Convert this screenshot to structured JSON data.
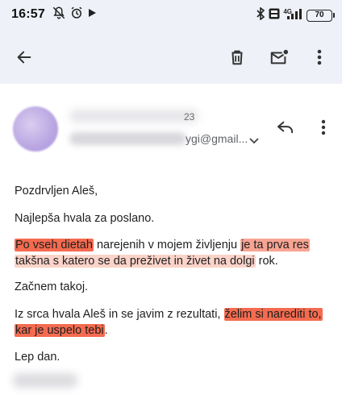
{
  "status_bar": {
    "time": "16:57",
    "network": "4G",
    "battery": "70",
    "icons": [
      "mute-icon",
      "alarm-icon",
      "play-icon",
      "bluetooth-icon",
      "volte-icon",
      "signal-icon",
      "battery-icon"
    ]
  },
  "toolbar": {
    "icons": [
      "back-arrow-icon",
      "trash-icon",
      "mark-unread-icon",
      "more-vert-icon"
    ]
  },
  "email": {
    "date_fragment": "23",
    "sender_address_fragment": "ygi@gmail...",
    "paragraphs": {
      "greeting": "Pozdrvljen Aleš,",
      "thanks": "Najlepša hvala za poslano.",
      "p3_line1": [
        "Po vseh dietah",
        " narejenih v mojem življenju ",
        "je ta prva res"
      ],
      "p3_line2": [
        "takšna s katero se da preživet in živet na dolgi",
        " rok."
      ],
      "p4": "Začnem takoj.",
      "p5_line1": [
        "Iz srca hvala Aleš in se javim z rezultati,  ",
        "želim si narediti to,"
      ],
      "p5_line2": [
        "kar je uspelo tebi",
        "."
      ],
      "closing": "Lep dan."
    }
  },
  "colors": {
    "header_bg": "#eef2f8",
    "highlight_strong": "#f46b4f",
    "highlight_mid": "#f8a493",
    "highlight_soft": "#fbd3c9"
  }
}
